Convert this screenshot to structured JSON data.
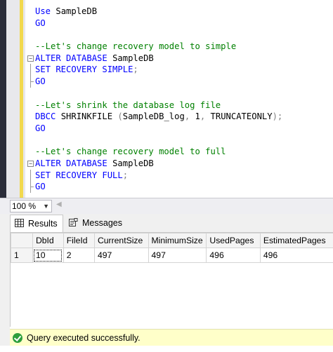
{
  "editor": {
    "lines": [
      {
        "segments": [
          {
            "t": "Use ",
            "c": "kw"
          },
          {
            "t": "SampleDB",
            "c": "pl"
          }
        ]
      },
      {
        "segments": [
          {
            "t": "GO",
            "c": "kw"
          }
        ]
      },
      {
        "segments": []
      },
      {
        "segments": [
          {
            "t": "--Let's change recovery model to simple",
            "c": "cm"
          }
        ]
      },
      {
        "fold": "start",
        "segments": [
          {
            "t": "ALTER DATABASE ",
            "c": "kw"
          },
          {
            "t": "SampleDB",
            "c": "pl"
          }
        ]
      },
      {
        "fold": "mid",
        "segments": [
          {
            "t": "SET RECOVERY SIMPLE",
            "c": "kw"
          },
          {
            "t": ";",
            "c": "gr"
          }
        ]
      },
      {
        "fold": "end",
        "segments": [
          {
            "t": "GO",
            "c": "kw"
          }
        ]
      },
      {
        "segments": []
      },
      {
        "segments": [
          {
            "t": "--Let's shrink the database log file",
            "c": "cm"
          }
        ]
      },
      {
        "segments": [
          {
            "t": "DBCC ",
            "c": "kw"
          },
          {
            "t": "SHRINKFILE ",
            "c": "pl"
          },
          {
            "t": "(",
            "c": "gr"
          },
          {
            "t": "SampleDB_log",
            "c": "pl"
          },
          {
            "t": ", ",
            "c": "gr"
          },
          {
            "t": "1",
            "c": "pl"
          },
          {
            "t": ", ",
            "c": "gr"
          },
          {
            "t": "TRUNCATEONLY",
            "c": "pl"
          },
          {
            "t": ");",
            "c": "gr"
          }
        ]
      },
      {
        "segments": [
          {
            "t": "GO",
            "c": "kw"
          }
        ]
      },
      {
        "segments": []
      },
      {
        "segments": [
          {
            "t": "--Let's change recovery model to full",
            "c": "cm"
          }
        ]
      },
      {
        "fold": "start",
        "segments": [
          {
            "t": "ALTER DATABASE ",
            "c": "kw"
          },
          {
            "t": "SampleDB",
            "c": "pl"
          }
        ]
      },
      {
        "fold": "mid",
        "segments": [
          {
            "t": "SET RECOVERY FULL",
            "c": "kw"
          },
          {
            "t": ";",
            "c": "gr"
          }
        ]
      },
      {
        "fold": "end",
        "segments": [
          {
            "t": "GO",
            "c": "kw"
          }
        ]
      }
    ]
  },
  "zoom": {
    "value": "100 %"
  },
  "tabs": {
    "results_label": "Results",
    "messages_label": "Messages"
  },
  "grid": {
    "columns": [
      "DbId",
      "FileId",
      "CurrentSize",
      "MinimumSize",
      "UsedPages",
      "EstimatedPages"
    ],
    "rows": [
      {
        "num": "1",
        "cells": [
          "10",
          "2",
          "497",
          "497",
          "496",
          "496"
        ]
      }
    ]
  },
  "status": {
    "message": "Query executed successfully."
  },
  "colors": {
    "keyword": "#0000ff",
    "comment": "#008000",
    "status_bg": "#ffffc9",
    "success": "#2e9e3c"
  },
  "icons": {
    "results": "grid-icon",
    "messages": "messages-icon",
    "status": "success-check-icon"
  }
}
